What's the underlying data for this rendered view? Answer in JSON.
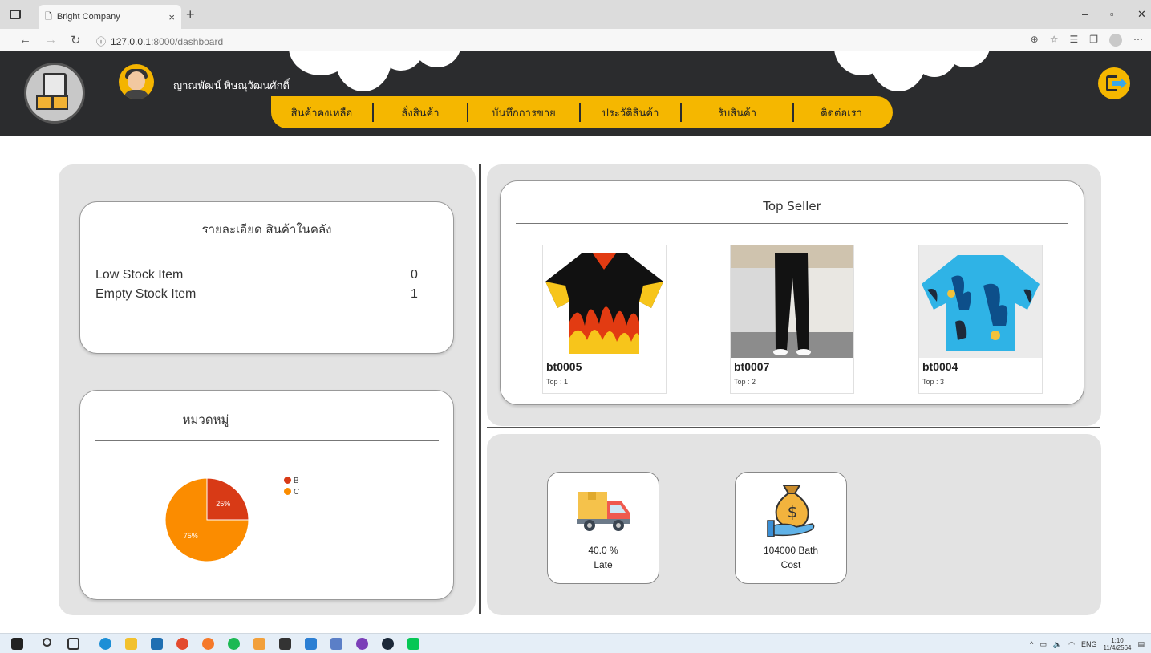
{
  "browser": {
    "tab_title": "Bright Company",
    "tab_close": "×",
    "new_tab": "+",
    "url_host": "127.0.0.1",
    "url_path": ":8000/dashboard",
    "window_controls": [
      "–",
      "▫",
      "✕"
    ],
    "toolbar_icons": [
      "zoom-icon",
      "favorite-icon",
      "favorites-bar-icon",
      "collections-icon",
      "profile-icon",
      "more-icon"
    ]
  },
  "header": {
    "username": "ญาณพัฒน์ พิษณุวัฒนศักดิ์",
    "menu": [
      {
        "label": "สินค้าคงเหลือ",
        "width": 128
      },
      {
        "label": "สั่งสินค้า",
        "width": 118
      },
      {
        "label": "บันทึกการขาย",
        "width": 140
      },
      {
        "label": "ประวัติสินค้า",
        "width": 126
      },
      {
        "label": "รับสินค้า",
        "width": 140
      },
      {
        "label": "ติดต่อเรา",
        "width": 118
      }
    ],
    "colors": {
      "bar": "#2b2c2e",
      "accent": "#f5b700"
    }
  },
  "stock_card": {
    "title": "รายละเอียด สินค้าในคลัง",
    "rows": [
      {
        "label": "Low Stock Item",
        "value": "0"
      },
      {
        "label": "Empty Stock Item",
        "value": "1"
      }
    ]
  },
  "category_card": {
    "title": "หมวดหมู่",
    "chart_data": {
      "type": "pie",
      "categories": [
        "B",
        "C"
      ],
      "values": [
        25,
        75
      ],
      "labels": [
        "25%",
        "75%"
      ],
      "colors": [
        "#d83a16",
        "#fb8c00"
      ],
      "legend": "top-right"
    }
  },
  "top_seller": {
    "title": "Top Seller",
    "items": [
      {
        "code": "bt0005",
        "rank": "Top : 1"
      },
      {
        "code": "bt0007",
        "rank": "Top : 2"
      },
      {
        "code": "bt0004",
        "rank": "Top : 3"
      }
    ]
  },
  "kpis": [
    {
      "value": "40.0 %",
      "label": "Late",
      "icon": "delivery-truck-icon"
    },
    {
      "value": "104000 Bath",
      "label": "Cost",
      "icon": "money-bag-icon"
    }
  ],
  "taskbar": {
    "tray_text": "ENG",
    "time": "1:10",
    "date": "11/4/2564"
  }
}
